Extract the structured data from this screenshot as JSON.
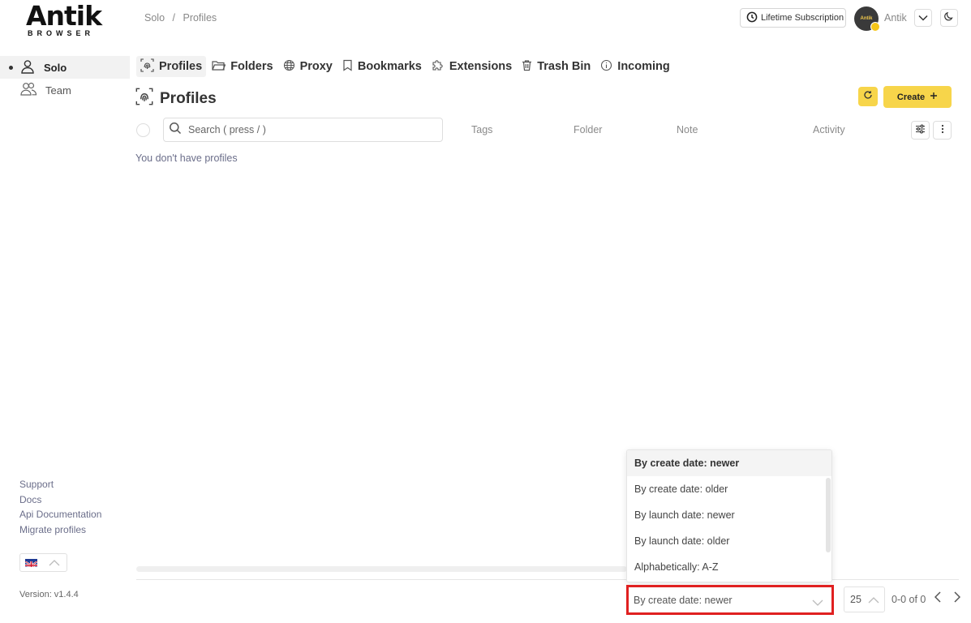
{
  "brand": {
    "logo_word": "Antik",
    "logo_sub": "BROWSER"
  },
  "breadcrumb": {
    "root": "Solo",
    "separator": "/",
    "current": "Profiles"
  },
  "header": {
    "subscription_label": "Lifetime Subscription",
    "avatar_text": "Antik",
    "username": "Antik"
  },
  "sidebar": {
    "items": [
      {
        "label": "Solo",
        "icon": "user-icon",
        "active": true
      },
      {
        "label": "Team",
        "icon": "users-icon",
        "active": false
      }
    ],
    "links": [
      "Support",
      "Docs",
      "Api Documentation",
      "Migrate profiles"
    ],
    "version": "Version: v1.4.4"
  },
  "tabs": [
    {
      "label": "Profiles",
      "icon": "fingerprint-icon",
      "active": true
    },
    {
      "label": "Folders",
      "icon": "folder-icon"
    },
    {
      "label": "Proxy",
      "icon": "globe-icon"
    },
    {
      "label": "Bookmarks",
      "icon": "bookmark-icon"
    },
    {
      "label": "Extensions",
      "icon": "puzzle-icon"
    },
    {
      "label": "Trash Bin",
      "icon": "trash-icon"
    },
    {
      "label": "Incoming",
      "icon": "info-icon"
    }
  ],
  "main": {
    "title": "Profiles",
    "create_label": "Create",
    "search_placeholder": "Search ( press / )",
    "columns": [
      "Tags",
      "Folder",
      "Note",
      "Activity"
    ],
    "empty_message": "You don't have profiles"
  },
  "footer": {
    "sort_options": [
      "By create date: newer",
      "By create date: older",
      "By launch date: newer",
      "By launch date: older",
      "Alphabetically: A-Z"
    ],
    "sort_selected": "By create date: newer",
    "per_page": "25",
    "page_info": "0-0 of 0"
  },
  "colors": {
    "accent": "#f7d54a",
    "highlight_border": "#e02020"
  }
}
